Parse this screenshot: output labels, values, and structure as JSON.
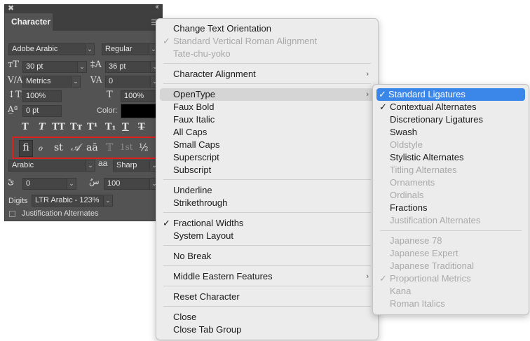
{
  "panel": {
    "tab_label": "Character",
    "font_family": "Adobe Arabic",
    "font_style": "Regular",
    "font_size": "30 pt",
    "leading": "36 pt",
    "kerning": "Metrics",
    "tracking": "0",
    "vertical_scale": "100%",
    "horizontal_scale": "100%",
    "baseline_shift": "0 pt",
    "color_label": "Color:",
    "language": "Arabic",
    "antialias_icon": "aa",
    "antialias": "Sharp",
    "diacritic_vertical": "0",
    "diacritic_horizontal": "100",
    "digits_label": "Digits",
    "digits_value": "LTR Arabic - 123%",
    "justification_alternates": "Justification Alternates",
    "style_buttons": [
      "T",
      "T",
      "TT",
      "Tт",
      "T¹",
      "T₁",
      "T",
      "T"
    ],
    "opentype_buttons": [
      "fi",
      "ℴ",
      "st",
      "𝒜",
      "aā",
      "𝕋",
      "1st",
      "½"
    ],
    "colors": {
      "panel_bg": "#535353",
      "highlight_border": "#e0201c"
    }
  },
  "main_menu": {
    "items": [
      {
        "label": "Change Text Orientation",
        "enabled": true
      },
      {
        "label": "Standard Vertical Roman Alignment",
        "enabled": false,
        "checked": true
      },
      {
        "label": "Tate-chu-yoko",
        "enabled": false
      },
      {
        "label": "Character Alignment",
        "submenu": true
      },
      {
        "label": "OpenType",
        "submenu": true,
        "highlighted": true
      },
      {
        "label": "Faux Bold"
      },
      {
        "label": "Faux Italic"
      },
      {
        "label": "All Caps"
      },
      {
        "label": "Small Caps"
      },
      {
        "label": "Superscript"
      },
      {
        "label": "Subscript"
      },
      {
        "label": "Underline"
      },
      {
        "label": "Strikethrough"
      },
      {
        "label": "Fractional Widths",
        "checked": true
      },
      {
        "label": "System Layout"
      },
      {
        "label": "No Break"
      },
      {
        "label": "Middle Eastern Features",
        "submenu": true
      },
      {
        "label": "Reset Character"
      },
      {
        "label": "Close"
      },
      {
        "label": "Close Tab Group"
      }
    ],
    "check_glyph": "✓",
    "arrow_glyph": "›"
  },
  "opentype_menu": {
    "items": [
      {
        "label": "Standard Ligatures",
        "checked": true,
        "selected": true
      },
      {
        "label": "Contextual Alternates",
        "checked": true
      },
      {
        "label": "Discretionary Ligatures"
      },
      {
        "label": "Swash"
      },
      {
        "label": "Oldstyle",
        "enabled": false
      },
      {
        "label": "Stylistic Alternates"
      },
      {
        "label": "Titling Alternates",
        "enabled": false
      },
      {
        "label": "Ornaments",
        "enabled": false
      },
      {
        "label": "Ordinals",
        "enabled": false
      },
      {
        "label": "Fractions"
      },
      {
        "label": "Justification Alternates",
        "enabled": false
      },
      {
        "label": "Japanese 78",
        "enabled": false
      },
      {
        "label": "Japanese Expert",
        "enabled": false
      },
      {
        "label": "Japanese Traditional",
        "enabled": false
      },
      {
        "label": "Proportional Metrics",
        "enabled": false,
        "checked": true
      },
      {
        "label": "Kana",
        "enabled": false
      },
      {
        "label": "Roman Italics",
        "enabled": false
      }
    ],
    "selection_color": "#3b86e9"
  }
}
